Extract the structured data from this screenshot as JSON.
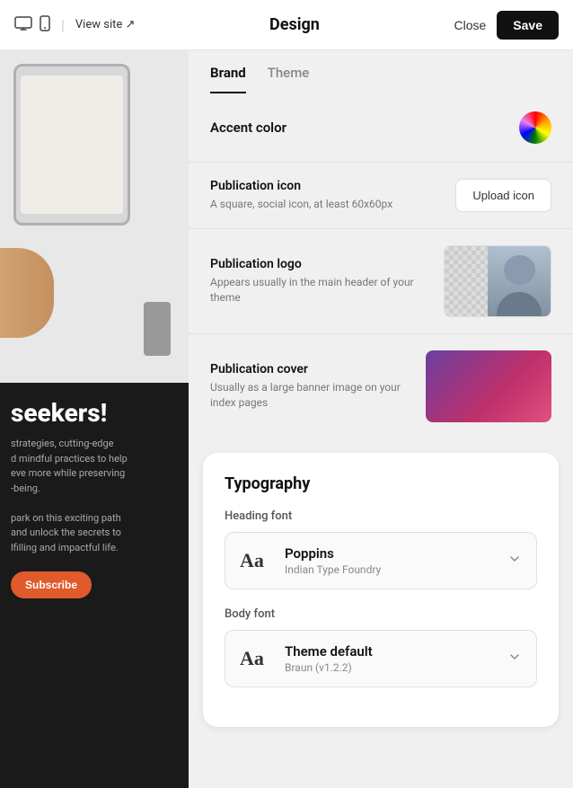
{
  "topbar": {
    "title": "Design",
    "close_label": "Close",
    "save_label": "Save",
    "view_site_label": "View site ↗"
  },
  "tabs": [
    {
      "id": "brand",
      "label": "Brand",
      "active": true
    },
    {
      "id": "theme",
      "label": "Theme",
      "active": false
    }
  ],
  "brand": {
    "accent_color_label": "Accent color",
    "publication_icon": {
      "title": "Publication icon",
      "description": "A square, social icon, at least 60x60px",
      "action_label": "Upload icon"
    },
    "publication_logo": {
      "title": "Publication logo",
      "description": "Appears usually in the main header of your theme"
    },
    "publication_cover": {
      "title": "Publication cover",
      "description": "Usually as a large banner image on your index pages"
    }
  },
  "typography": {
    "title": "Typography",
    "heading_font": {
      "label": "Heading font",
      "font_name": "Poppins",
      "font_foundry": "Indian Type Foundry",
      "aa_label": "Aa"
    },
    "body_font": {
      "label": "Body font",
      "font_name": "Theme default",
      "font_version": "Braun (v1.2.2)",
      "aa_label": "Aa"
    }
  },
  "preview": {
    "seekers_text": "seekers!",
    "body_line1": "strategies, cutting-edge",
    "body_line2": "d mindful practices to help",
    "body_line3": "eve more while preserving",
    "body_line4": "-being.",
    "body_line5": "",
    "body_line6": "park on this exciting path",
    "body_line7": "and unlock the secrets to",
    "body_line8": "lfilling and impactful life.",
    "subscribe_label": "Subscribe"
  },
  "icons": {
    "monitor": "⊟",
    "mobile": "▭",
    "chevron_down": "⌄",
    "external_link": "↗"
  }
}
